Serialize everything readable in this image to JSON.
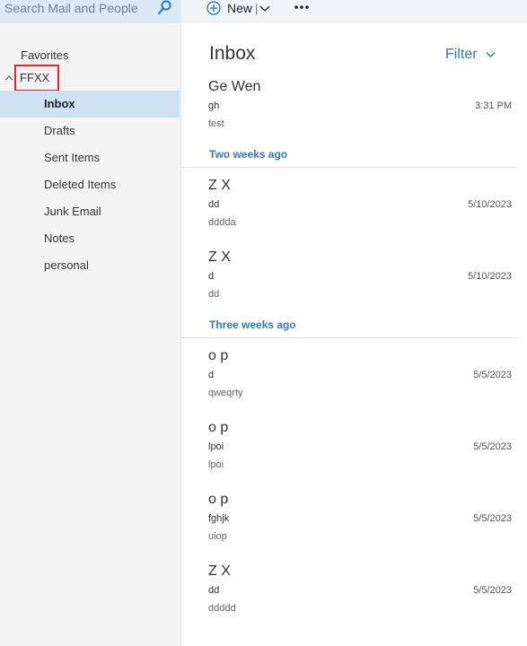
{
  "search": {
    "placeholder": "Search Mail and People"
  },
  "toolbar": {
    "new_label": "New",
    "separator": "|"
  },
  "sidebar": {
    "favorites_label": "Favorites",
    "account_label": "FFXX",
    "folders": [
      {
        "label": "Inbox",
        "selected": true
      },
      {
        "label": "Drafts"
      },
      {
        "label": "Sent Items"
      },
      {
        "label": "Deleted Items"
      },
      {
        "label": "Junk Email"
      },
      {
        "label": "Notes"
      },
      {
        "label": "personal"
      }
    ]
  },
  "main": {
    "title": "Inbox",
    "filter_label": "Filter",
    "groups": [
      {
        "label": "Two weeks ago"
      },
      {
        "label": "Three weeks ago"
      }
    ],
    "messages": [
      {
        "sender": "Ge Wen",
        "subject": "gh",
        "preview": "test",
        "date": "3:31 PM"
      },
      {
        "sender": "Z X",
        "subject": "dd",
        "preview": "dddda",
        "date": "5/10/2023"
      },
      {
        "sender": "Z X",
        "subject": "d",
        "preview": "dd",
        "date": "5/10/2023"
      },
      {
        "sender": "o p",
        "subject": "d",
        "preview": "qweqrty",
        "date": "5/5/2023"
      },
      {
        "sender": "o p",
        "subject": "lpoi",
        "preview": "lpoi",
        "date": "5/5/2023"
      },
      {
        "sender": "o p",
        "subject": "fghjk",
        "preview": "uiop",
        "date": "5/5/2023"
      },
      {
        "sender": "Z X",
        "subject": "dd",
        "preview": "ddddd",
        "date": "5/5/2023"
      }
    ]
  },
  "colors": {
    "accent": "#2f7ac4",
    "selected_folder": "#cde2f4",
    "highlight_box": "#e0242c"
  }
}
